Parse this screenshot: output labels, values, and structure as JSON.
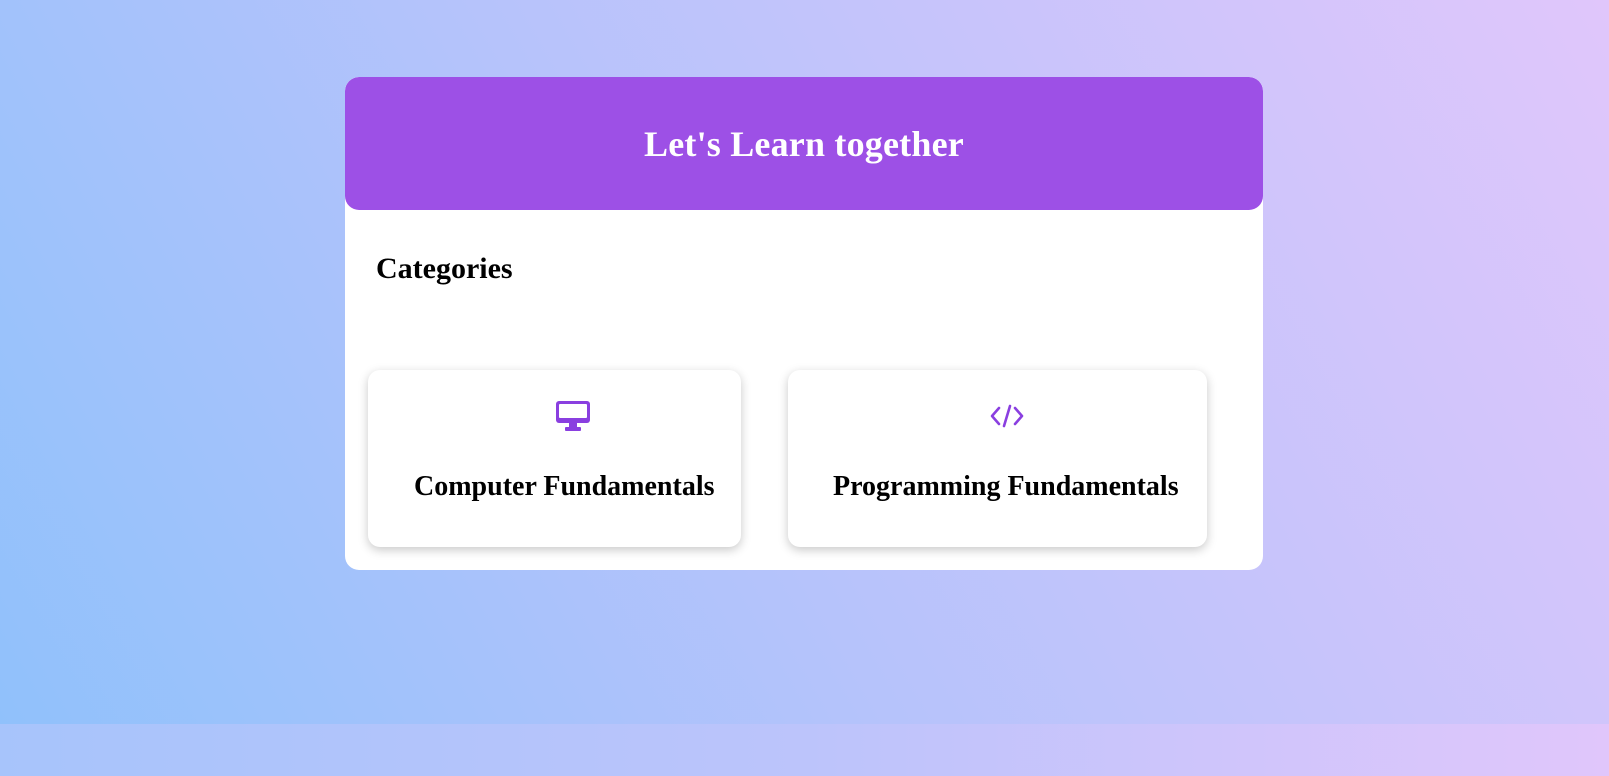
{
  "colors": {
    "accent": "#9d50e6",
    "icon": "#8a3fe0",
    "background_start": "#8fc1fb",
    "background_end": "#e0c6fb"
  },
  "header": {
    "title": "Let's Learn together"
  },
  "categories": {
    "title": "Categories",
    "items": [
      {
        "label": "Computer Fundamentals",
        "icon": "desktop-monitor-icon"
      },
      {
        "label": "Programming Fundamentals",
        "icon": "code-brackets-icon"
      }
    ]
  }
}
